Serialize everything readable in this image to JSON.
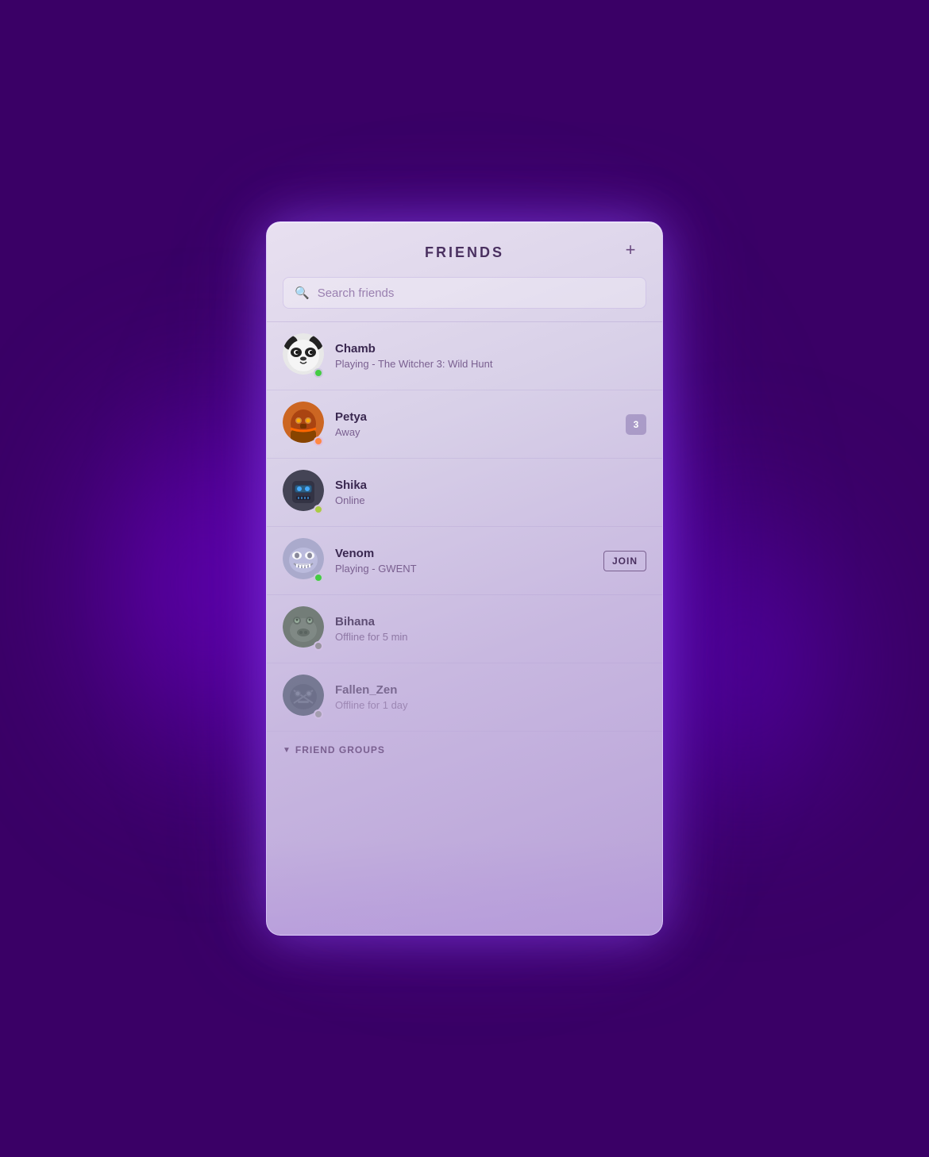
{
  "panel": {
    "title": "FRIENDS",
    "add_button_label": "+",
    "search": {
      "placeholder": "Search friends"
    }
  },
  "friends": [
    {
      "id": "chamb",
      "name": "Chamb",
      "status_text": "Playing - The Witcher 3: Wild Hunt",
      "status_type": "ingame",
      "badge": null,
      "action": null,
      "avatar_type": "panda"
    },
    {
      "id": "petya",
      "name": "Petya",
      "status_text": "Away",
      "status_type": "away",
      "badge": "3",
      "action": null,
      "avatar_type": "warrior"
    },
    {
      "id": "shika",
      "name": "Shika",
      "status_text": "Online",
      "status_type": "online",
      "badge": null,
      "action": null,
      "avatar_type": "robot"
    },
    {
      "id": "venom",
      "name": "Venom",
      "status_text": "Playing - GWENT",
      "status_type": "ingame",
      "badge": null,
      "action": "JOIN",
      "avatar_type": "symbiote"
    },
    {
      "id": "bihana",
      "name": "Bihana",
      "status_text": "Offline for 5 min",
      "status_type": "offline",
      "badge": null,
      "action": null,
      "avatar_type": "creature"
    },
    {
      "id": "fallen_zen",
      "name": "Fallen_Zen",
      "status_text": "Offline for 1 day",
      "status_type": "offline",
      "badge": null,
      "action": null,
      "avatar_type": "dark"
    }
  ],
  "footer": {
    "label": "FRIEND GROUPS"
  },
  "status_colors": {
    "ingame": "#44cc44",
    "online": "#44cc44",
    "away": "#ff8844",
    "offline": "#888888"
  }
}
